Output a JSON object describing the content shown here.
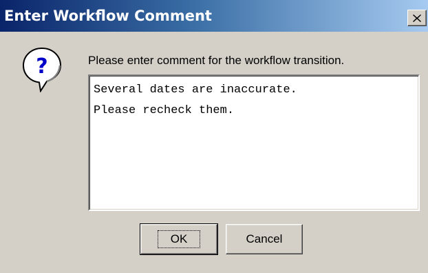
{
  "dialog": {
    "title": "Enter Workflow Comment",
    "close_icon": "close-icon",
    "message_icon": "question-icon",
    "prompt": "Please enter comment for the workflow transition.",
    "comment_lines": [
      "Several dates are inaccurate.",
      "Please recheck them."
    ],
    "ok_label": "OK",
    "cancel_label": "Cancel"
  },
  "colors": {
    "title_bar_start": "#0a246a",
    "title_bar_end": "#a6caf0",
    "window_face": "#d4d0c8",
    "icon_accent": "#0000c8"
  }
}
